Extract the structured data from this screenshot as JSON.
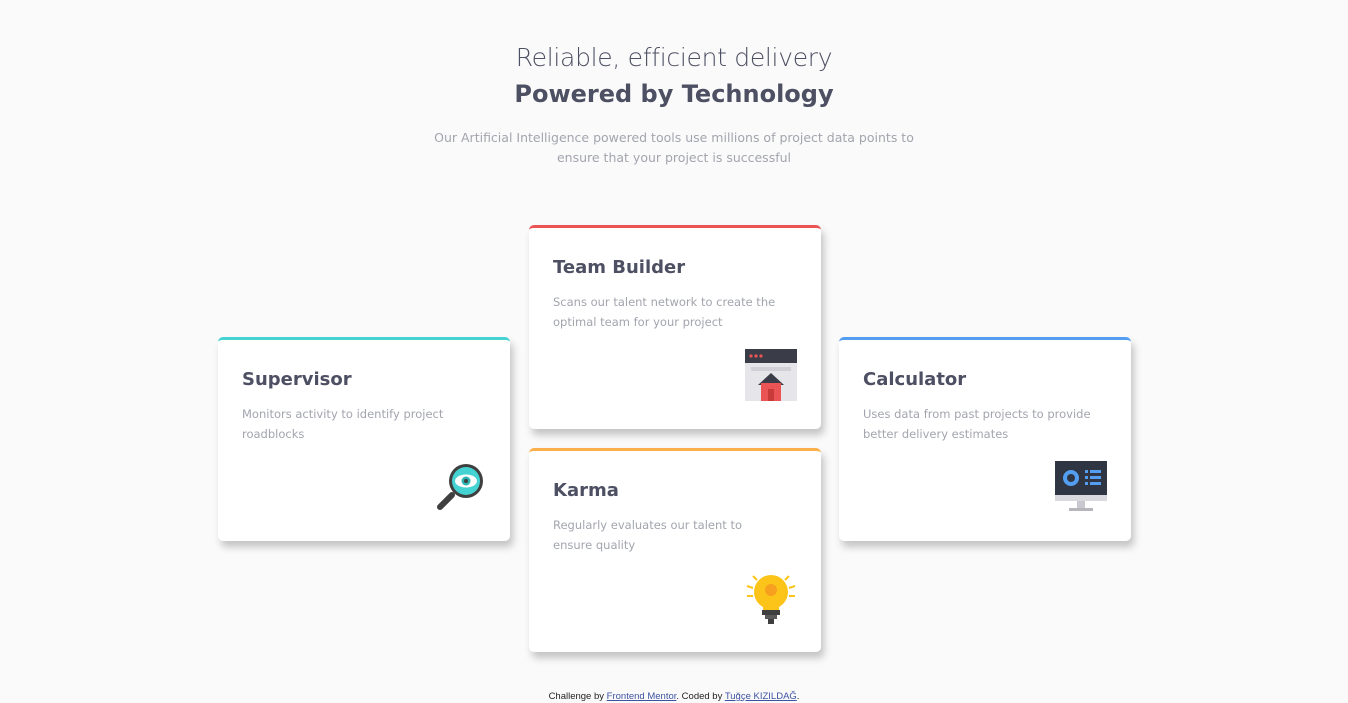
{
  "header": {
    "subtitle": "Reliable, efficient delivery",
    "title": "Powered by Technology",
    "intro": "Our Artificial Intelligence powered tools use millions of project data points to ensure that your project is successful"
  },
  "cards": [
    {
      "title": "Supervisor",
      "desc": "Monitors activity to identify project roadblocks",
      "accent": "#44d3d2",
      "icon": "magnifier-eye-icon"
    },
    {
      "title": "Team Builder",
      "desc": "Scans our talent network to create the optimal team for your project",
      "accent": "#ea5454",
      "icon": "browser-home-icon"
    },
    {
      "title": "Karma",
      "desc": "Regularly evaluates our talent to ensure quality",
      "accent": "#fcaf4a",
      "icon": "lightbulb-icon"
    },
    {
      "title": "Calculator",
      "desc": "Uses data from past projects to provide better delivery estimates",
      "accent": "#549ef2",
      "icon": "monitor-dashboard-icon"
    }
  ],
  "footer": {
    "prefix": "Challenge by ",
    "challenge_link": "Frontend Mentor",
    "middle": ". Coded by ",
    "author_link": "Tuğçe KIZILDAĞ",
    "suffix": "."
  }
}
